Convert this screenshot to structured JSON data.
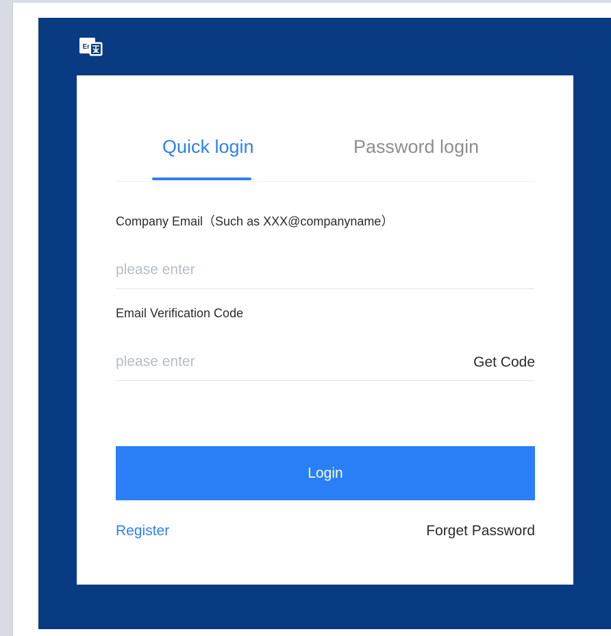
{
  "header": {
    "language_icon": "translate-en-icon",
    "background_color": "#083B82"
  },
  "tabs": [
    {
      "label": "Quick login",
      "active": true
    },
    {
      "label": "Password login",
      "active": false
    }
  ],
  "form": {
    "email": {
      "label": "Company Email（Such as XXX@companyname）",
      "placeholder": "please enter",
      "value": ""
    },
    "code": {
      "label": "Email Verification Code",
      "placeholder": "please enter",
      "value": "",
      "get_code_label": "Get Code"
    }
  },
  "actions": {
    "login_label": "Login",
    "register_label": "Register",
    "forget_password_label": "Forget Password"
  },
  "colors": {
    "accent": "#2A7FF7",
    "text_primary": "#2B2B2B",
    "text_muted": "#8D8D8D",
    "placeholder": "#B7BCC5"
  }
}
